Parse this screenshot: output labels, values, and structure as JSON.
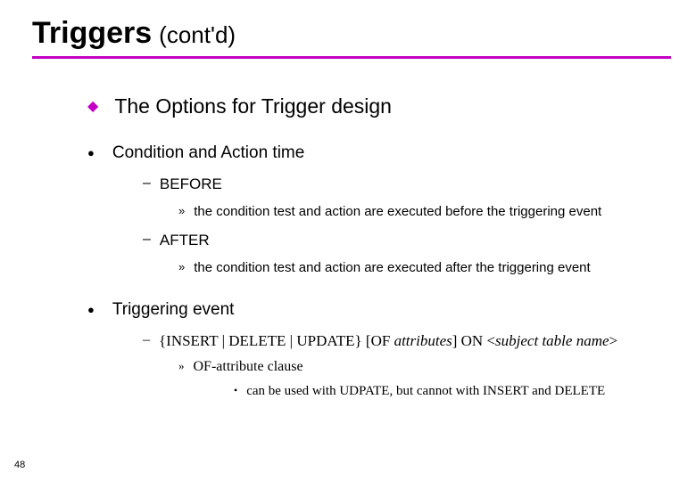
{
  "title": {
    "bold": "Triggers",
    "light": "(cont'd)"
  },
  "lv1": "The Options for Trigger design",
  "section1": {
    "heading": "Condition and Action time",
    "items": [
      {
        "name": "BEFORE",
        "desc": "the condition test and action are executed before the triggering event"
      },
      {
        "name": "AFTER",
        "desc": "the condition test and action are executed after the triggering event"
      }
    ]
  },
  "section2": {
    "heading": "Triggering event",
    "syntax_parts": {
      "p1": "{INSERT | DELETE | UPDATE}  [OF ",
      "p2": "attributes",
      "p3": "]   ON <",
      "p4": "subject table name",
      "p5": ">"
    },
    "sub": "OF-attribute clause",
    "subnote": "can be used with UDPATE, but cannot with  INSERT and DELETE"
  },
  "pageNumber": "48"
}
